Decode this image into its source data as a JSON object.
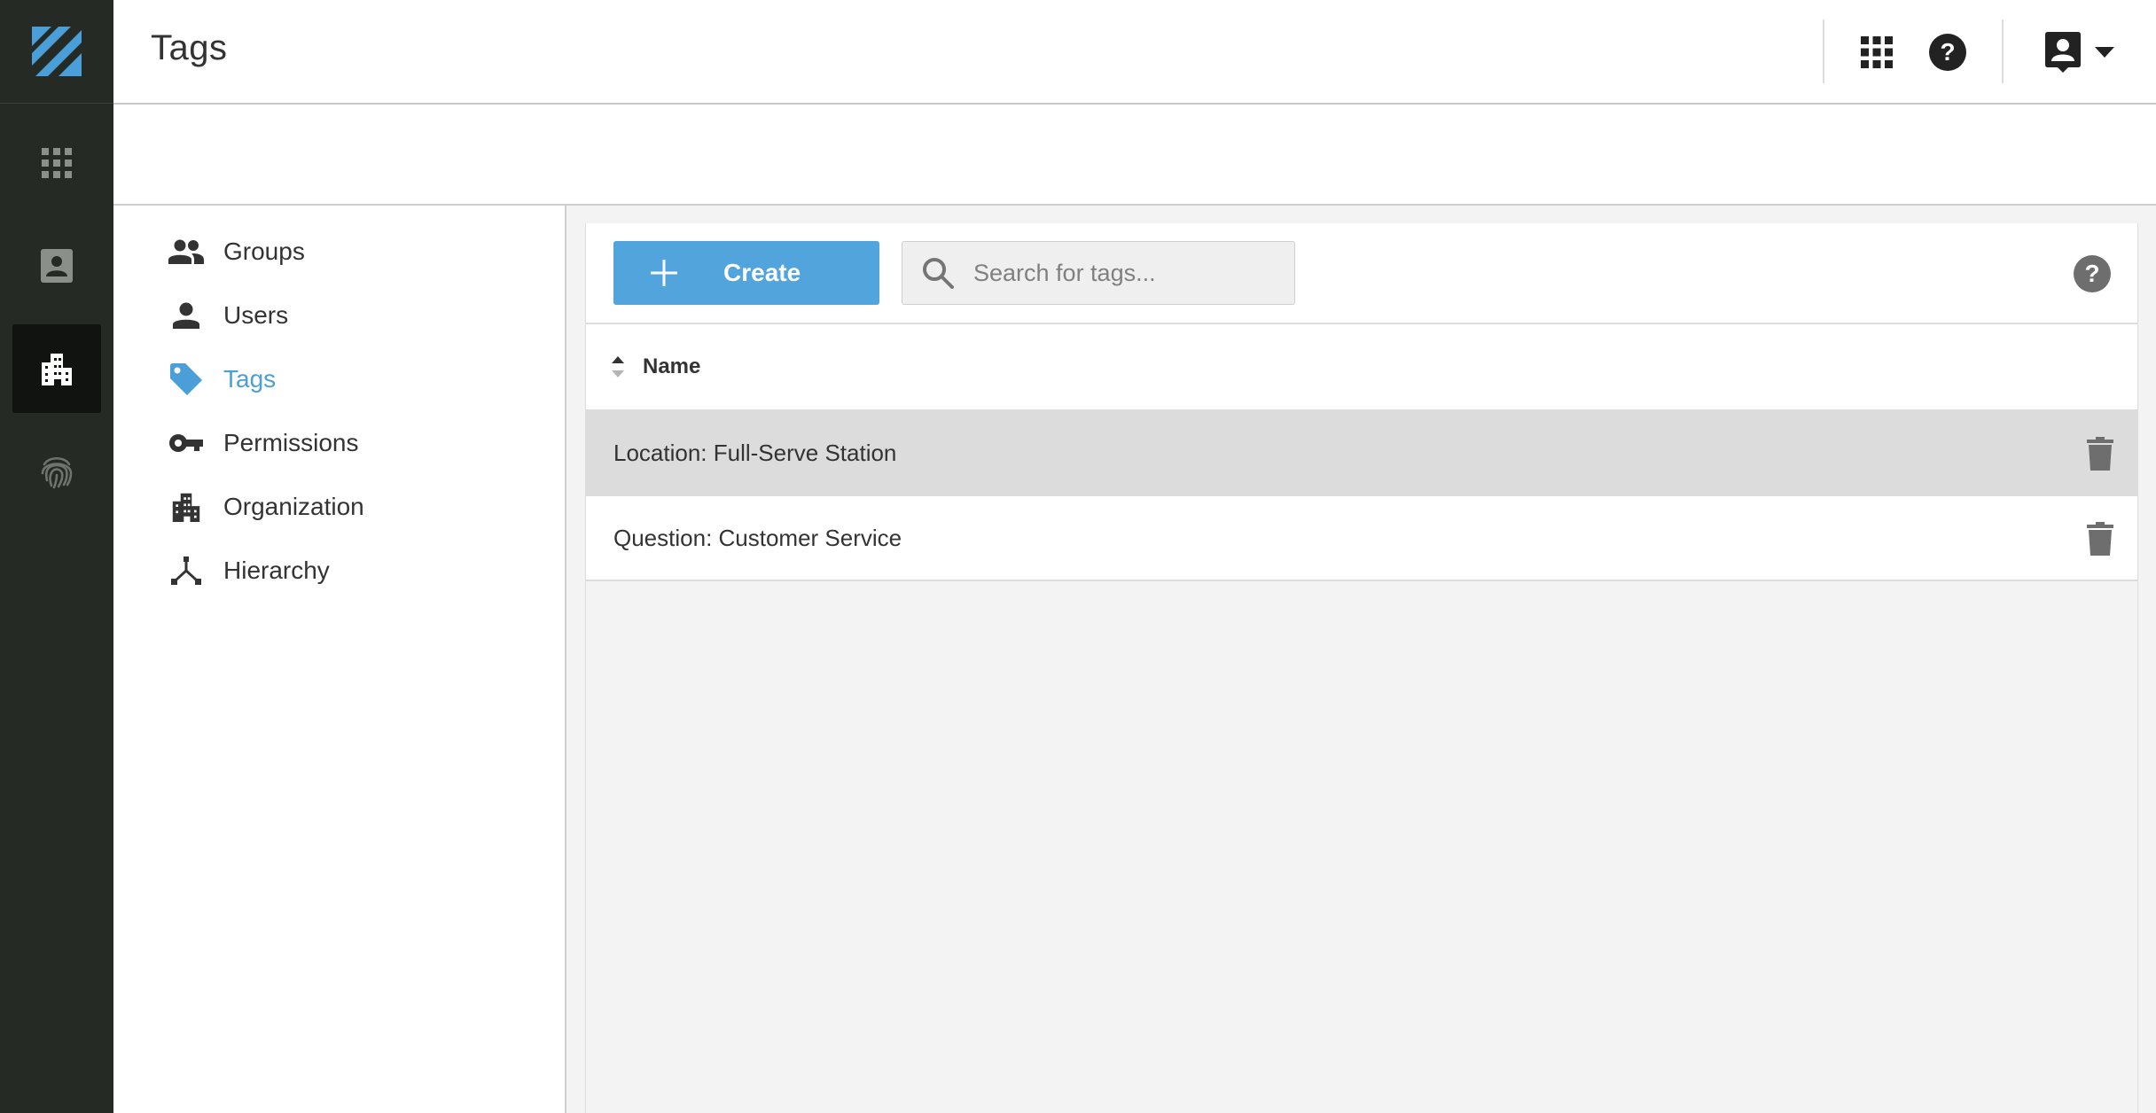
{
  "header": {
    "title": "Tags"
  },
  "rail": {
    "items": [
      {
        "icon": "apps-grid-icon"
      },
      {
        "icon": "contact-card-icon"
      },
      {
        "icon": "building-icon",
        "active": true
      },
      {
        "icon": "fingerprint-icon"
      }
    ]
  },
  "subnav": {
    "items": [
      {
        "label": "Groups",
        "icon": "groups-icon"
      },
      {
        "label": "Users",
        "icon": "user-icon"
      },
      {
        "label": "Tags",
        "icon": "tag-icon",
        "active": true
      },
      {
        "label": "Permissions",
        "icon": "key-icon"
      },
      {
        "label": "Organization",
        "icon": "building-icon"
      },
      {
        "label": "Hierarchy",
        "icon": "hierarchy-icon"
      }
    ]
  },
  "toolbar": {
    "create_label": "Create",
    "search_placeholder": "Search for tags..."
  },
  "table": {
    "column_name": "Name",
    "rows": [
      {
        "name": "Location: Full-Serve Station"
      },
      {
        "name": "Question: Customer Service"
      }
    ]
  },
  "colors": {
    "accent": "#52a4dd",
    "rail_bg": "#252a25",
    "active_nav": "#4a9fd8"
  }
}
